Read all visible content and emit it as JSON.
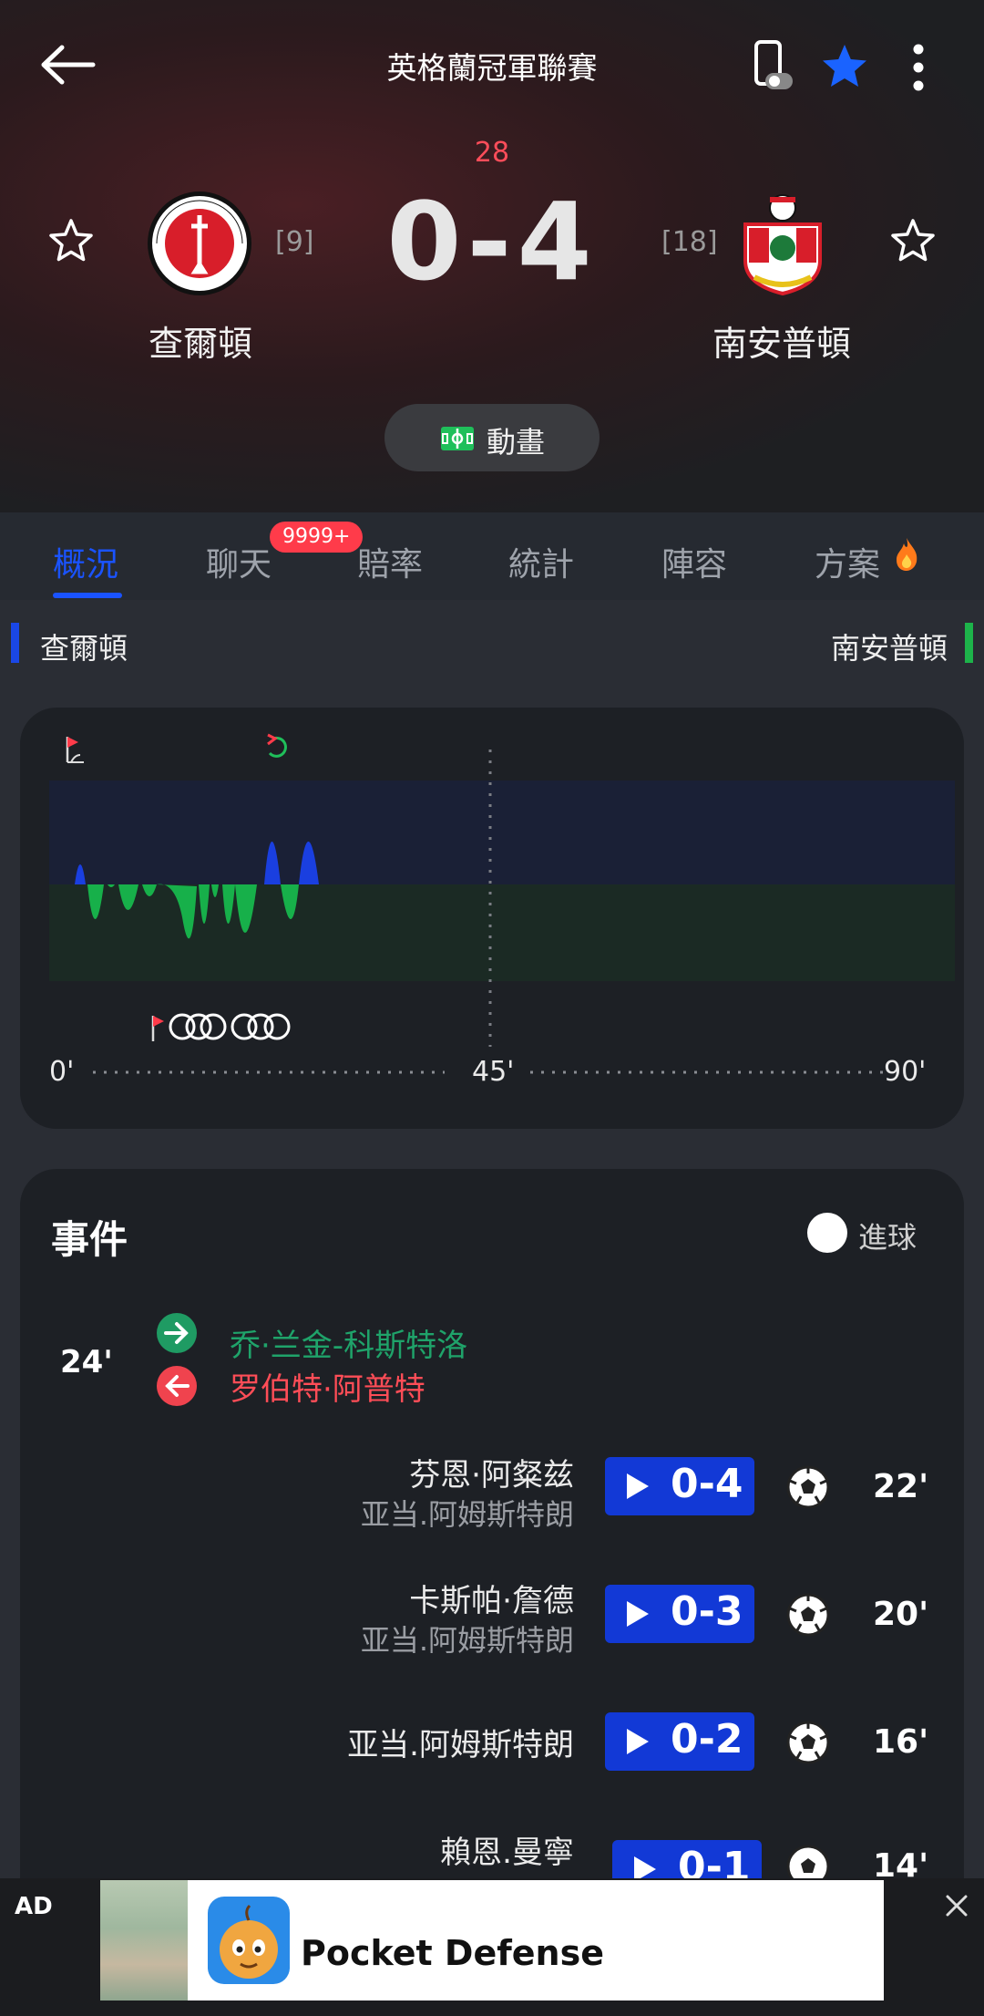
{
  "header": {
    "title": "英格蘭冠軍聯賽",
    "minute": "28",
    "score": "0-4",
    "home": {
      "name": "查爾頓",
      "rank": "[9]"
    },
    "away": {
      "name": "南安普頓",
      "rank": "[18]"
    },
    "animation_label": "動畫"
  },
  "tabs": [
    {
      "label": "概況",
      "active": true
    },
    {
      "label": "聊天",
      "badge": "9999+"
    },
    {
      "label": "賠率"
    },
    {
      "label": "統計"
    },
    {
      "label": "陣容"
    },
    {
      "label": "方案"
    }
  ],
  "sides": {
    "home": "查爾頓",
    "away": "南安普頓"
  },
  "momentum": {
    "axis": {
      "start": "0'",
      "half": "45'",
      "end": "90'"
    }
  },
  "events": {
    "title": "事件",
    "legend_goal": "進球",
    "substitution": {
      "minute": "24'",
      "player_in": "乔·兰金-科斯特洛",
      "player_out": "罗伯特·阿普特"
    },
    "goals": [
      {
        "scorer": "芬恩·阿粲兹",
        "assist": "亚当.阿姆斯特朗",
        "score": "0-4",
        "minute": "22'"
      },
      {
        "scorer": "卡斯帕·詹德",
        "assist": "亚当.阿姆斯特朗",
        "score": "0-3",
        "minute": "20'"
      },
      {
        "scorer": "亚当.阿姆斯特朗",
        "assist": "",
        "score": "0-2",
        "minute": "16'"
      },
      {
        "scorer": "賴恩.曼寧",
        "assist": "",
        "score": "0-1",
        "minute": "14'"
      }
    ]
  },
  "ad": {
    "label": "AD",
    "app_name": "Pocket Defense"
  },
  "colors": {
    "accent": "#1a53ff",
    "home": "#1a47e6",
    "away": "#1db34a",
    "alert": "#ff3b4a"
  }
}
